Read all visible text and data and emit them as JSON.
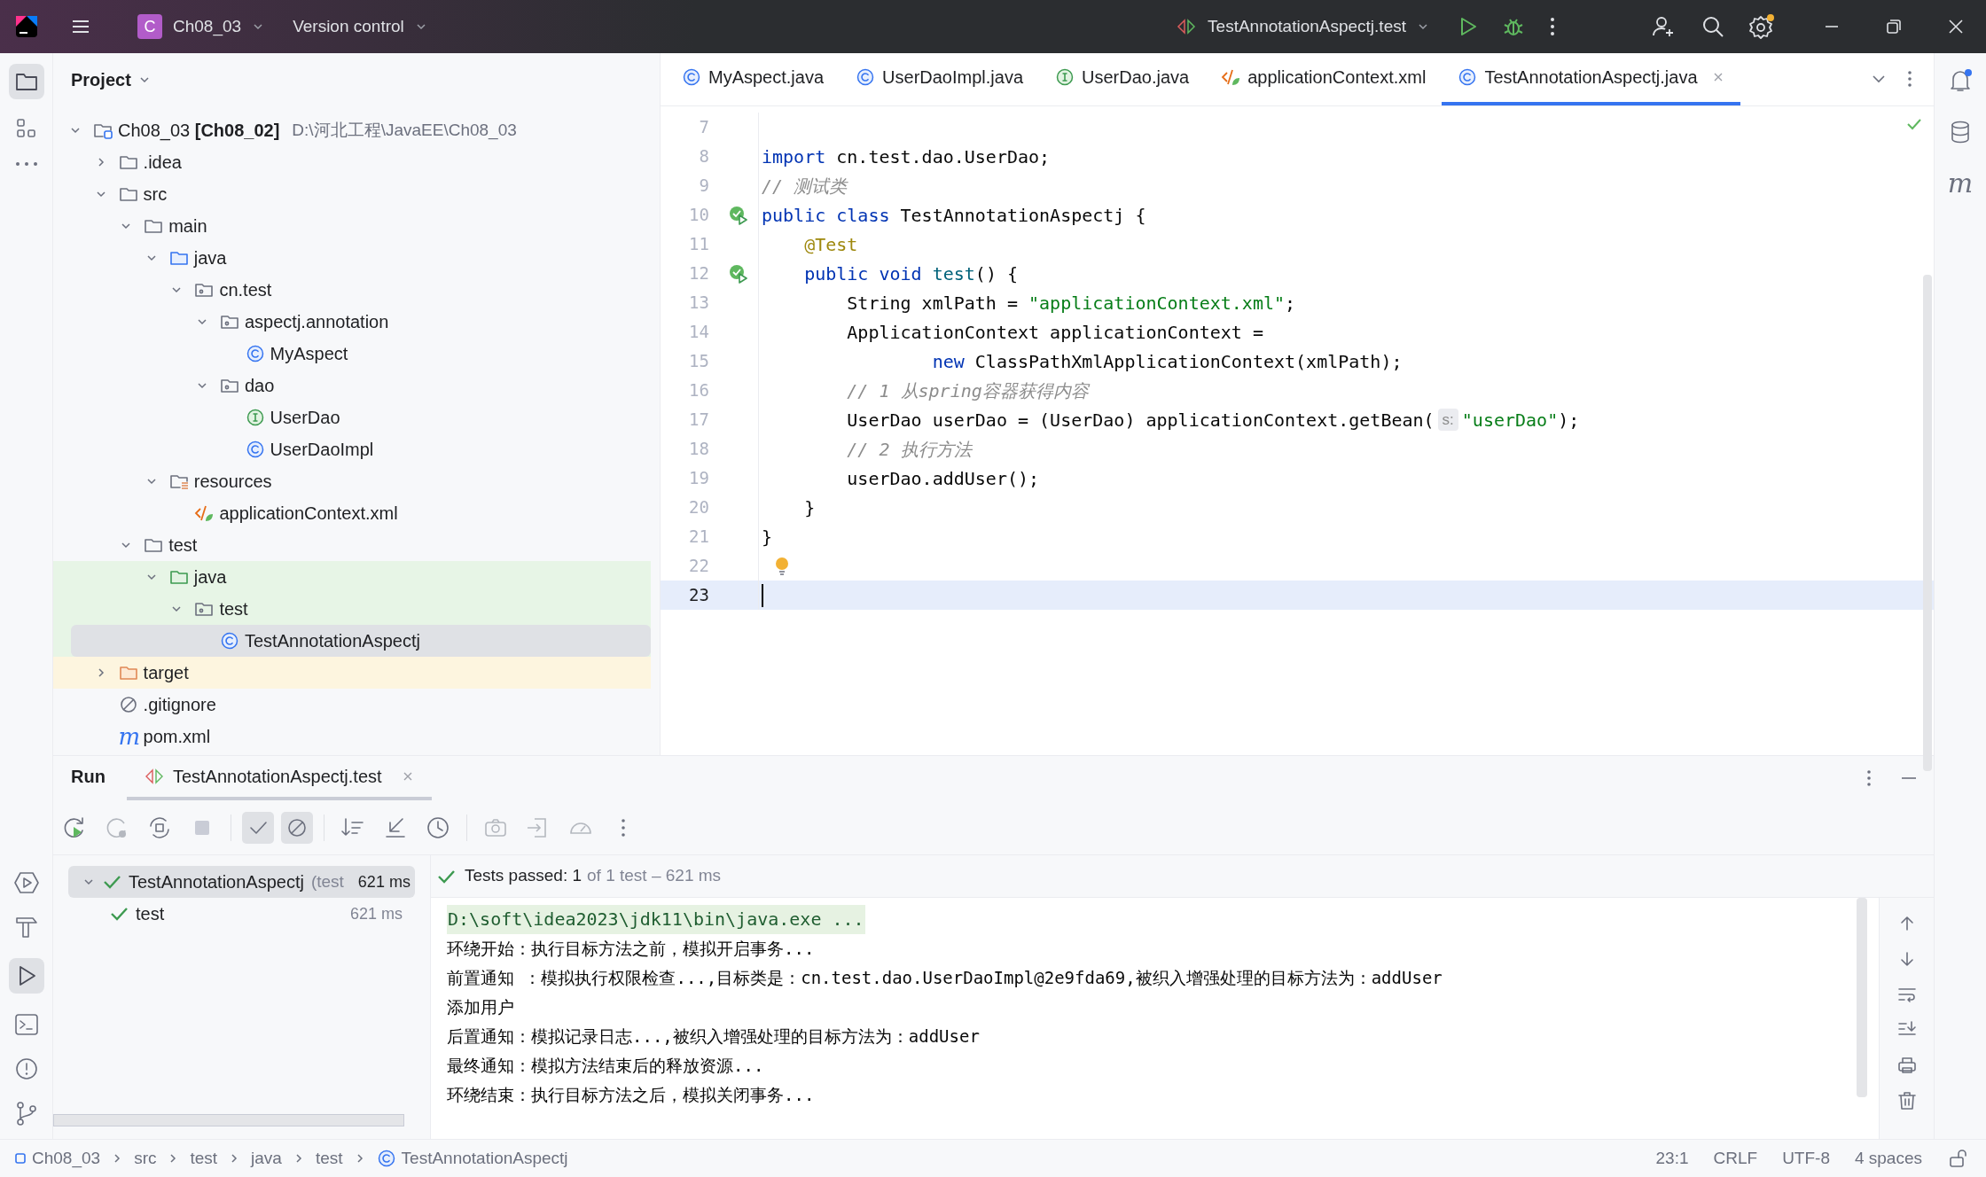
{
  "title_bar": {
    "project_badge": "C",
    "project": "Ch08_03",
    "vcs": "Version control",
    "run_config": "TestAnnotationAspectj.test"
  },
  "project_panel": {
    "title": "Project",
    "tree": [
      {
        "label": "Ch08_03 **[Ch08_02]**",
        "path": "D:\\河北工程\\JavaEE\\Ch08_03",
        "kind": "module",
        "expanded": true,
        "selected": false,
        "children": [
          {
            "label": ".idea",
            "kind": "folder",
            "expanded": false,
            "selected": false
          },
          {
            "label": "src",
            "kind": "folder",
            "expanded": true,
            "selected": false,
            "children": [
              {
                "label": "main",
                "kind": "folder",
                "expanded": true,
                "selected": false,
                "children": [
                  {
                    "label": "java",
                    "kind": "source",
                    "expanded": true,
                    "selected": false,
                    "children": [
                      {
                        "label": "cn.test",
                        "kind": "package",
                        "expanded": true,
                        "selected": false,
                        "children": [
                          {
                            "label": "aspectj.annotation",
                            "kind": "package",
                            "expanded": true,
                            "selected": false,
                            "children": [
                              {
                                "label": "MyAspect",
                                "kind": "class",
                                "selected": false
                              }
                            ]
                          },
                          {
                            "label": "dao",
                            "kind": "package",
                            "expanded": true,
                            "selected": false,
                            "children": [
                              {
                                "label": "UserDao",
                                "kind": "interface",
                                "selected": false
                              },
                              {
                                "label": "UserDaoImpl",
                                "kind": "class",
                                "selected": false
                              }
                            ]
                          }
                        ]
                      }
                    ]
                  },
                  {
                    "label": "resources",
                    "kind": "resources",
                    "expanded": true,
                    "selected": false,
                    "children": [
                      {
                        "label": "applicationContext.xml",
                        "kind": "xml",
                        "selected": false
                      }
                    ]
                  }
                ]
              },
              {
                "label": "test",
                "kind": "folder",
                "expanded": true,
                "selected": false,
                "children": [
                  {
                    "label": "java",
                    "kind": "test_source",
                    "expanded": true,
                    "selected": false,
                    "children": [
                      {
                        "label": "test",
                        "kind": "package",
                        "expanded": true,
                        "selected": false,
                        "children": [
                          {
                            "label": "TestAnnotationAspectj",
                            "kind": "class",
                            "selected": true
                          }
                        ]
                      }
                    ]
                  }
                ]
              }
            ]
          },
          {
            "label": "target",
            "kind": "excluded",
            "expanded": false,
            "selected": false
          },
          {
            "label": ".gitignore",
            "kind": "ignore",
            "selected": false
          },
          {
            "label": "pom.xml",
            "kind": "maven",
            "glyph": "m",
            "selected": false
          }
        ]
      }
    ]
  },
  "editor": {
    "tabs": [
      {
        "label": "MyAspect.java",
        "kind": "class",
        "selected": false
      },
      {
        "label": "UserDaoImpl.java",
        "kind": "class",
        "selected": false
      },
      {
        "label": "UserDao.java",
        "kind": "interface",
        "selected": false
      },
      {
        "label": "applicationContext.xml",
        "kind": "xml",
        "selected": false
      },
      {
        "label": "TestAnnotationAspectj.java",
        "kind": "class",
        "selected": true
      }
    ],
    "lines": [
      {
        "number": "7",
        "current": false
      },
      {
        "number": "8",
        "current": false,
        "tokens": [
          {
            "kind": "kw",
            "text": "import"
          },
          {
            "kind": "plain",
            "text": " cn.test.dao.UserDao;"
          }
        ]
      },
      {
        "number": "9",
        "current": false,
        "tokens": [
          {
            "kind": "comment",
            "text": "// 测试类"
          }
        ]
      },
      {
        "number": "10",
        "current": false,
        "runnable": true,
        "tokens": [
          {
            "kind": "kw",
            "text": "public class"
          },
          {
            "kind": "plain",
            "text": " TestAnnotationAspectj {"
          }
        ]
      },
      {
        "number": "11",
        "current": false,
        "tokens": [
          {
            "kind": "annotation",
            "text": "    @Test"
          }
        ]
      },
      {
        "number": "12",
        "current": false,
        "runnable": true,
        "tokens": [
          {
            "kind": "kw",
            "text": "    public void"
          },
          {
            "kind": "method",
            "text": " test"
          },
          {
            "kind": "plain",
            "text": "() {"
          }
        ]
      },
      {
        "number": "13",
        "current": false,
        "tokens": [
          {
            "kind": "plain",
            "text": "        String xmlPath = "
          },
          {
            "kind": "string",
            "text": "\"applicationContext.xml\""
          },
          {
            "kind": "plain",
            "text": ";"
          }
        ]
      },
      {
        "number": "14",
        "current": false,
        "tokens": [
          {
            "kind": "plain",
            "text": "        ApplicationContext applicationContext ="
          }
        ]
      },
      {
        "number": "15",
        "current": false,
        "tokens": [
          {
            "kind": "kw",
            "text": "                new"
          },
          {
            "kind": "plain",
            "text": " ClassPathXmlApplicationContext(xmlPath);"
          }
        ]
      },
      {
        "number": "16",
        "current": false,
        "tokens": [
          {
            "kind": "comment",
            "text": "        // 1 从spring容器获得内容"
          }
        ]
      },
      {
        "number": "17",
        "current": false,
        "tokens": [
          {
            "kind": "plain",
            "text": "        UserDao userDao = (UserDao) applicationContext.getBean("
          },
          {
            "kind": "hint",
            "text": "s:"
          },
          {
            "kind": "string",
            "text": "\"userDao\""
          },
          {
            "kind": "plain",
            "text": ");"
          }
        ]
      },
      {
        "number": "18",
        "current": false,
        "tokens": [
          {
            "kind": "comment",
            "text": "        // 2 执行方法"
          }
        ]
      },
      {
        "number": "19",
        "current": false,
        "tokens": [
          {
            "kind": "plain",
            "text": "        userDao.addUser();"
          }
        ]
      },
      {
        "number": "20",
        "current": false,
        "tokens": [
          {
            "kind": "plain",
            "text": "    }"
          }
        ]
      },
      {
        "number": "21",
        "current": false,
        "tokens": [
          {
            "kind": "plain",
            "text": "}"
          }
        ]
      },
      {
        "number": "22",
        "current": false,
        "bulb": true
      },
      {
        "number": "23",
        "current": true
      }
    ]
  },
  "run_panel": {
    "tabs": [
      {
        "label": "Run",
        "selected": false
      },
      {
        "label": "TestAnnotationAspectj.test",
        "selected": true
      }
    ],
    "toolbar": {
      "show_passed": true,
      "show_ignored": true
    },
    "tests": [
      {
        "label": "TestAnnotationAspectj",
        "detail": "(test",
        "time": "621 ms",
        "passed": true,
        "expanded": true,
        "selected": true,
        "children": [
          {
            "label": "test",
            "time": "621 ms",
            "passed": true,
            "selected": false
          }
        ]
      }
    ],
    "summary": {
      "status": "Tests passed: 1",
      "detail": "of 1 test – 621 ms",
      "passed": true
    },
    "console": [
      {
        "kind": "command",
        "text": "D:\\soft\\idea2023\\jdk11\\bin\\java.exe ..."
      },
      {
        "kind": "output",
        "text": "环绕开始：执行目标方法之前，模拟开启事务..."
      },
      {
        "kind": "output",
        "text": "前置通知 ：模拟执行权限检查...,目标类是：cn.test.dao.UserDaoImpl@2e9fda69,被织入增强处理的目标方法为：addUser"
      },
      {
        "kind": "output",
        "text": "添加用户"
      },
      {
        "kind": "output",
        "text": "后置通知：模拟记录日志...,被织入增强处理的目标方法为：addUser"
      },
      {
        "kind": "output",
        "text": "最终通知：模拟方法结束后的释放资源..."
      },
      {
        "kind": "output",
        "text": "环绕结束：执行目标方法之后，模拟关闭事务..."
      }
    ]
  },
  "right_strip": {
    "maven_glyph": "m"
  },
  "status_bar": {
    "breadcrumbs": [
      {
        "label": "Ch08_03",
        "kind": "module"
      },
      {
        "label": "src",
        "kind": "folder"
      },
      {
        "label": "test",
        "kind": "folder"
      },
      {
        "label": "java",
        "kind": "folder"
      },
      {
        "label": "test",
        "kind": "folder"
      },
      {
        "label": "TestAnnotationAspectj",
        "kind": "class"
      }
    ],
    "position": "23:1",
    "line_separator": "CRLF",
    "encoding": "UTF-8",
    "indent": "4 spaces"
  }
}
